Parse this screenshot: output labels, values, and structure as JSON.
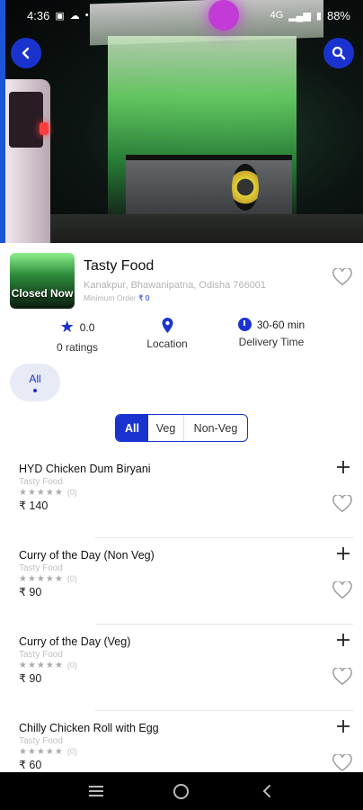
{
  "status_bar": {
    "time": "4:36",
    "network": "4G",
    "battery": "88%"
  },
  "header": {
    "back_icon": "back-arrow-icon",
    "search_icon": "search-icon"
  },
  "restaurant": {
    "name": "Tasty Food",
    "status": "Closed Now",
    "address": "Kanakpur, Bhawanipatna, Odisha 766001",
    "min_order_label": "Minimum Order",
    "min_order_value": "₹ 0"
  },
  "stats": {
    "rating_value": "0.0",
    "rating_label": "0 ratings",
    "location_label": "Location",
    "delivery_time": "30-60 min",
    "delivery_label": "Delivery Time"
  },
  "category": {
    "label": "All"
  },
  "filter": {
    "options": [
      "All",
      "Veg",
      "Non-Veg"
    ],
    "selected": "All"
  },
  "menu_items": [
    {
      "name": "HYD Chicken Dum Biryani",
      "restaurant": "Tasty Food",
      "stars": "★★★★★",
      "rating_count": "(0)",
      "price": "₹ 140"
    },
    {
      "name": "Curry of the Day (Non Veg)",
      "restaurant": "Tasty Food",
      "stars": "★★★★★",
      "rating_count": "(0)",
      "price": "₹ 90"
    },
    {
      "name": "Curry of the Day (Veg)",
      "restaurant": "Tasty Food",
      "stars": "★★★★★",
      "rating_count": "(0)",
      "price": "₹ 90"
    },
    {
      "name": "Chilly Chicken Roll with Egg",
      "restaurant": "Tasty Food",
      "stars": "★★★★★",
      "rating_count": "(0)",
      "price": "₹ 60"
    }
  ],
  "colors": {
    "accent": "#1a33cf",
    "nav_bg": "#000000"
  }
}
